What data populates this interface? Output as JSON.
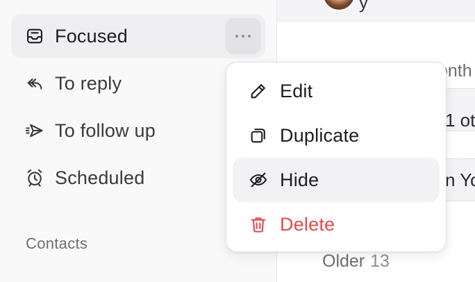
{
  "sidebar": {
    "items": [
      {
        "label": "Focused",
        "icon": "inbox-icon",
        "active": true
      },
      {
        "label": "To reply",
        "icon": "reply-icon"
      },
      {
        "label": "To follow up",
        "icon": "send-icon"
      },
      {
        "label": "Scheduled",
        "icon": "alarm-clock-icon"
      }
    ],
    "more_icon": "ellipsis-icon",
    "section_label": "Contacts"
  },
  "main": {
    "top_fragment": "y",
    "fragments": [
      "onth",
      "1 ot",
      "n Yo"
    ],
    "older": {
      "label": "Older",
      "count": "13"
    }
  },
  "context_menu": {
    "items": [
      {
        "label": "Edit",
        "icon": "pencil-icon"
      },
      {
        "label": "Duplicate",
        "icon": "duplicate-icon"
      },
      {
        "label": "Hide",
        "icon": "eye-off-icon",
        "hovered": true
      },
      {
        "label": "Delete",
        "icon": "trash-icon",
        "danger": true
      }
    ]
  },
  "colors": {
    "danger": "#e5484d",
    "active_bg": "#efeff1",
    "hover_bg": "#f2f2f4"
  }
}
